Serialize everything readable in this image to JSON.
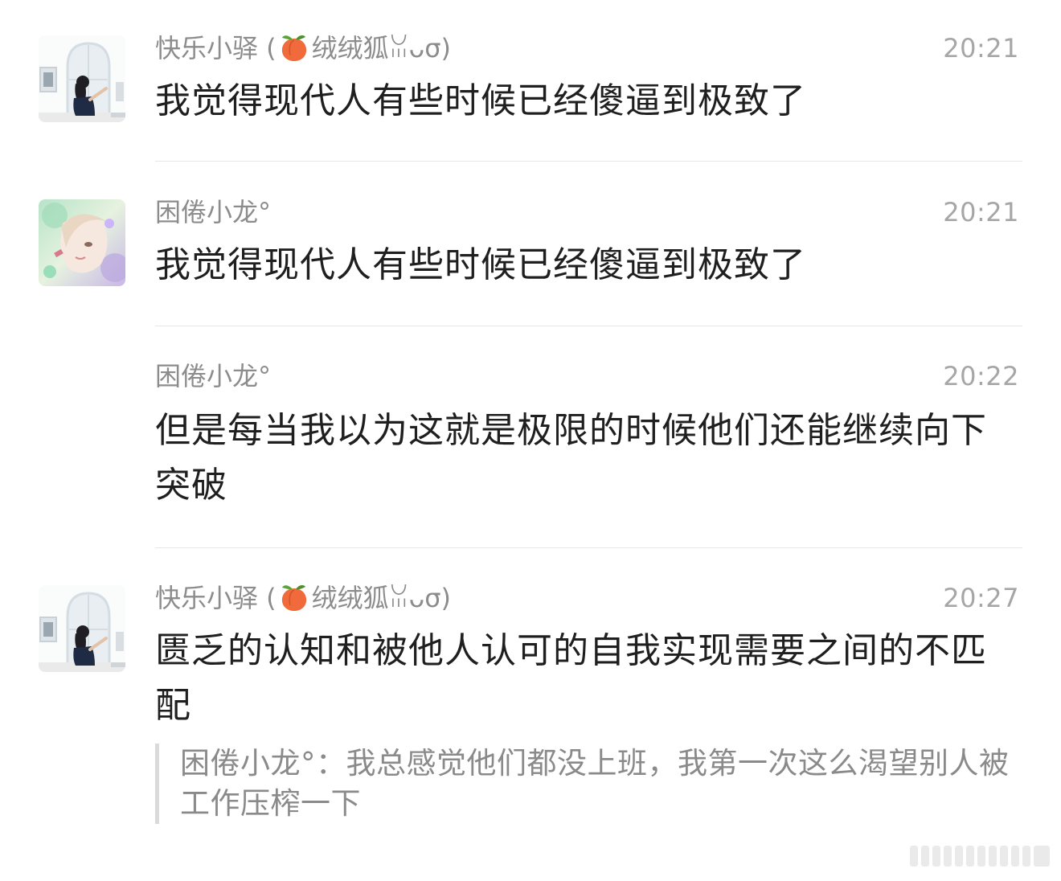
{
  "messages": [
    {
      "author": "快乐小驿 (🍑绒绒狐ᓚᘏᗢ)",
      "author_prefix": "快乐小驿 (",
      "author_emoji": "peach-emoji",
      "author_suffix": "绒绒狐ꈍᴗσ)",
      "time": "20:21",
      "text": "我觉得现代人有些时候已经傻逼到极致了",
      "avatar": "woman-painting-avatar"
    },
    {
      "author": "困倦小龙°",
      "time": "20:21",
      "text": "我觉得现代人有些时候已经傻逼到极致了",
      "avatar": "anime-girl-avatar"
    },
    {
      "author": "困倦小龙°",
      "time": "20:22",
      "text": "但是每当我以为这就是极限的时候他们还能继续向下突破"
    },
    {
      "author_prefix": "快乐小驿 (",
      "author_emoji": "peach-emoji",
      "author_suffix": "绒绒狐ꈍᴗσ)",
      "time": "20:27",
      "text": "匮乏的认知和被他人认可的自我实现需要之间的不匹配",
      "quote": "困倦小龙°：我总感觉他们都没上班，我第一次这么渴望别人被工作压榨一下",
      "avatar": "woman-painting-avatar"
    }
  ],
  "colors": {
    "author": "#8c8c8c",
    "time": "#a6a6a6",
    "content": "#1f1f1f",
    "quote": "#8a8a8a",
    "divider": "#e6e6e6"
  }
}
